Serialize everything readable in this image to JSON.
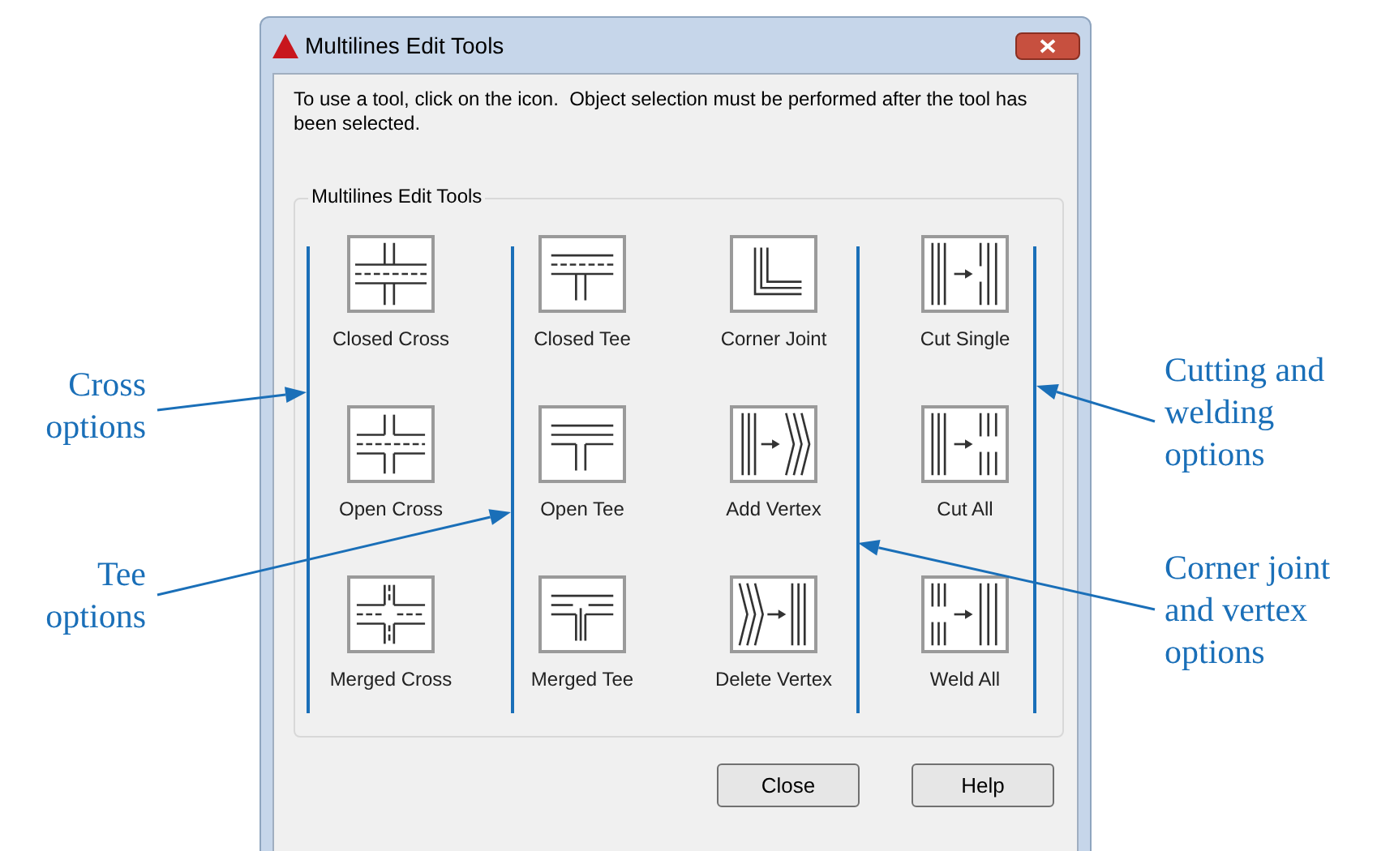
{
  "window": {
    "title": "Multilines Edit Tools"
  },
  "instructions": "To use a tool, click on the icon.  Object selection must be performed after the tool has been selected.",
  "group": {
    "label": "Multilines Edit Tools",
    "tools": [
      {
        "label": "Closed Cross",
        "kind": "closed-cross"
      },
      {
        "label": "Closed Tee",
        "kind": "closed-tee"
      },
      {
        "label": "Corner Joint",
        "kind": "corner-joint"
      },
      {
        "label": "Cut Single",
        "kind": "cut-single"
      },
      {
        "label": "Open Cross",
        "kind": "open-cross"
      },
      {
        "label": "Open Tee",
        "kind": "open-tee"
      },
      {
        "label": "Add Vertex",
        "kind": "add-vertex"
      },
      {
        "label": "Cut All",
        "kind": "cut-all"
      },
      {
        "label": "Merged Cross",
        "kind": "merged-cross"
      },
      {
        "label": "Merged Tee",
        "kind": "merged-tee"
      },
      {
        "label": "Delete Vertex",
        "kind": "delete-vertex"
      },
      {
        "label": "Weld All",
        "kind": "weld-all"
      }
    ]
  },
  "buttons": [
    "Close",
    "Help"
  ],
  "callouts": [
    {
      "text": "Cross options"
    },
    {
      "text": "Tee options"
    },
    {
      "text": "Cutting and welding options"
    },
    {
      "text": "Corner joint and vertex options"
    }
  ]
}
